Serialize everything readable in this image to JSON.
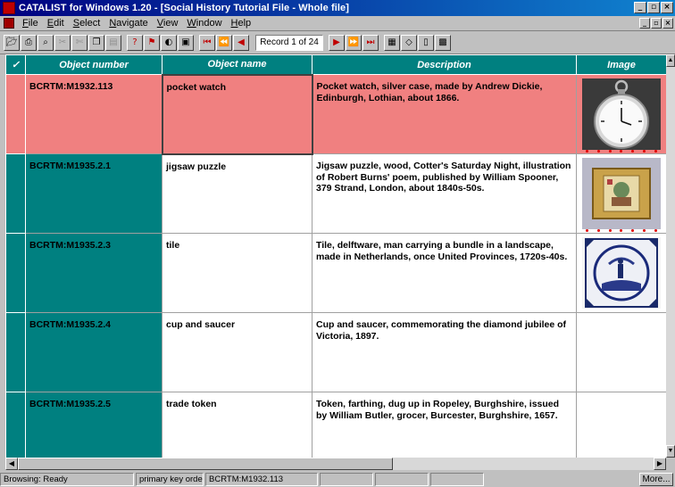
{
  "window": {
    "title": "CATALIST for Windows 1.20 - [Social History Tutorial File - Whole file]",
    "min_glyph": "_",
    "max_glyph": "▫",
    "close_glyph": "×"
  },
  "menu": [
    "File",
    "Edit",
    "Select",
    "Navigate",
    "View",
    "Window",
    "Help"
  ],
  "toolbar": {
    "record_indicator": "Record 1 of 24"
  },
  "grid": {
    "columns": [
      "Object number",
      "Object name",
      "Description",
      "Image"
    ],
    "select_header_glyph": "✓",
    "rows": [
      {
        "object_number": "BCRTM:M1932.113",
        "object_name": "pocket watch",
        "description": "Pocket watch, silver case, made by Andrew Dickie, Edinburgh, Lothian, about 1866.",
        "image": "pocket-watch"
      },
      {
        "object_number": "BCRTM:M1935.2.1",
        "object_name": "jigsaw puzzle",
        "description": "Jigsaw puzzle, wood, Cotter's Saturday Night, illustration of Robert Burns' poem, published by William Spooner, 379 Strand, London, about 1840s-50s.",
        "image": "jigsaw-box"
      },
      {
        "object_number": "BCRTM:M1935.2.3",
        "object_name": "tile",
        "description": "Tile, delftware, man carrying a bundle in a landscape, made in Netherlands, once United Provinces, 1720s-40s.",
        "image": "delft-tile"
      },
      {
        "object_number": "BCRTM:M1935.2.4",
        "object_name": "cup and saucer",
        "description": "Cup and saucer, commemorating the diamond jubilee of Victoria, 1897.",
        "image": ""
      },
      {
        "object_number": "BCRTM:M1935.2.5",
        "object_name": "trade token",
        "description": "Token, farthing, dug up in Ropeley, Burghshire, issued by William Butler, grocer, Burcester, Burghshire, 1657.",
        "image": ""
      }
    ]
  },
  "status": {
    "mode": "Browsing: Ready",
    "order": "primary key order",
    "current_key": "BCRTM:M1932.113",
    "more_label": "More..."
  },
  "colors": {
    "teal": "#008080",
    "current_row": "#f08080",
    "title_bar": "#000080"
  }
}
